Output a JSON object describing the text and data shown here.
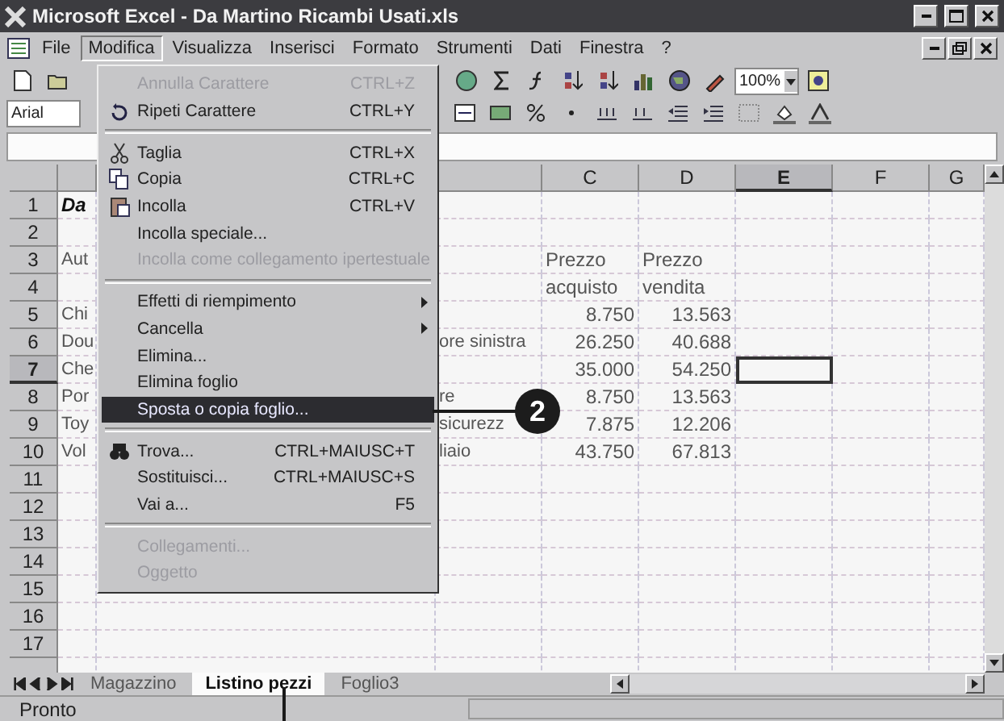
{
  "window": {
    "title": "Microsoft Excel - Da Martino Ricambi Usati.xls"
  },
  "menu_bar": [
    {
      "label": "File",
      "selected": false
    },
    {
      "label": "Modifica",
      "selected": true
    },
    {
      "label": "Visualizza",
      "selected": false
    },
    {
      "label": "Inserisci",
      "selected": false
    },
    {
      "label": "Formato",
      "selected": false
    },
    {
      "label": "Strumenti",
      "selected": false
    },
    {
      "label": "Dati",
      "selected": false
    },
    {
      "label": "Finestra",
      "selected": false
    },
    {
      "label": "?",
      "selected": false
    }
  ],
  "toolbar": {
    "font": "Arial",
    "zoom": "100%"
  },
  "open_menu": {
    "items": [
      {
        "kind": "item",
        "label": "Annulla Carattere",
        "shortcut": "CTRL+Z",
        "disabled": true,
        "selected": false
      },
      {
        "kind": "item",
        "label": "Ripeti Carattere",
        "shortcut": "CTRL+Y",
        "disabled": false,
        "selected": false
      },
      {
        "kind": "separator"
      },
      {
        "kind": "item",
        "label": "Taglia",
        "shortcut": "CTRL+X",
        "disabled": false,
        "selected": false
      },
      {
        "kind": "item",
        "label": "Copia",
        "shortcut": "CTRL+C",
        "disabled": false,
        "selected": false
      },
      {
        "kind": "item",
        "label": "Incolla",
        "shortcut": "CTRL+V",
        "disabled": false,
        "selected": false
      },
      {
        "kind": "item",
        "label": "Incolla speciale...",
        "disabled": false,
        "selected": false
      },
      {
        "kind": "item",
        "label": "Incolla come collegamento ipertestuale",
        "disabled": true,
        "selected": false
      },
      {
        "kind": "separator"
      },
      {
        "kind": "item",
        "label": "Effetti di riempimento",
        "submenu": true,
        "disabled": false,
        "selected": false
      },
      {
        "kind": "item",
        "label": "Cancella",
        "submenu": true,
        "disabled": false,
        "selected": false
      },
      {
        "kind": "item",
        "label": "Elimina...",
        "disabled": false,
        "selected": false
      },
      {
        "kind": "item",
        "label": "Elimina foglio",
        "disabled": false,
        "selected": false
      },
      {
        "kind": "item",
        "label": "Sposta o copia foglio...",
        "disabled": false,
        "selected": true
      },
      {
        "kind": "separator"
      },
      {
        "kind": "item",
        "label": "Trova...",
        "shortcut": "CTRL+MAIUSC+T",
        "disabled": false,
        "selected": false
      },
      {
        "kind": "item",
        "label": "Sostituisci...",
        "shortcut": "CTRL+MAIUSC+S",
        "disabled": false,
        "selected": false
      },
      {
        "kind": "item",
        "label": "Vai a...",
        "shortcut": "F5",
        "disabled": false,
        "selected": false
      },
      {
        "kind": "separator"
      },
      {
        "kind": "item",
        "label": "Collegamenti...",
        "disabled": true,
        "selected": false
      },
      {
        "kind": "item",
        "label": "Oggetto",
        "disabled": true,
        "selected": false
      }
    ]
  },
  "columns": [
    {
      "label": "C",
      "selected": false
    },
    {
      "label": "D",
      "selected": false
    },
    {
      "label": "E",
      "selected": true
    },
    {
      "label": "F",
      "selected": false
    },
    {
      "label": "G",
      "selected": false
    }
  ],
  "rows": [
    {
      "number": "1",
      "kind": "title",
      "selected": false,
      "a": "Da"
    },
    {
      "number": "2",
      "kind": "data",
      "selected": false
    },
    {
      "number": "3",
      "kind": "header",
      "selected": false,
      "a": "Aut",
      "c": "Prezzo",
      "d": "Prezzo"
    },
    {
      "number": "4",
      "kind": "header",
      "selected": false,
      "c": "acquisto",
      "d": "vendita"
    },
    {
      "number": "5",
      "kind": "data",
      "selected": false,
      "a": "Chi",
      "c": "8.750",
      "d": "13.563"
    },
    {
      "number": "6",
      "kind": "data",
      "selected": false,
      "a": "Dou",
      "b": "ore sinistra",
      "c": "26.250",
      "d": "40.688"
    },
    {
      "number": "7",
      "kind": "data",
      "selected": true,
      "a": "Che",
      "c": "35.000",
      "d": "54.250"
    },
    {
      "number": "8",
      "kind": "data",
      "selected": false,
      "a": "Por",
      "b": "re",
      "c": "8.750",
      "d": "13.563"
    },
    {
      "number": "9",
      "kind": "data",
      "selected": false,
      "a": "Toy",
      "b": "sicurezz",
      "c": "7.875",
      "d": "12.206"
    },
    {
      "number": "10",
      "kind": "data",
      "selected": false,
      "a": "Vol",
      "b": "liaio",
      "c": "43.750",
      "d": "67.813"
    },
    {
      "number": "11",
      "kind": "data",
      "selected": false
    },
    {
      "number": "12",
      "kind": "data",
      "selected": false
    },
    {
      "number": "13",
      "kind": "data",
      "selected": false
    },
    {
      "number": "14",
      "kind": "data",
      "selected": false
    },
    {
      "number": "15",
      "kind": "data",
      "selected": false
    },
    {
      "number": "16",
      "kind": "data",
      "selected": false
    },
    {
      "number": "17",
      "kind": "data",
      "selected": false
    }
  ],
  "sheet_tabs": [
    {
      "label": "Magazzino",
      "selected": false
    },
    {
      "label": "Listino pezzi",
      "selected": true
    },
    {
      "label": "Foglio3",
      "selected": false
    }
  ],
  "status_bar": {
    "text": "Pronto"
  },
  "callout": {
    "label": "2"
  }
}
